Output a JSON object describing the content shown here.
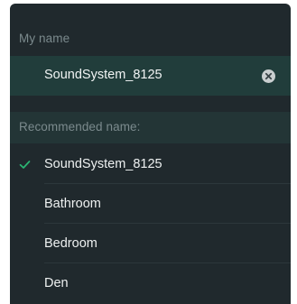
{
  "my_name": {
    "label": "My name",
    "value": "SoundSystem_8125",
    "clear_icon": "clear-circle-x-icon"
  },
  "recommended": {
    "label": "Recommended name:",
    "options": [
      {
        "label": "SoundSystem_8125",
        "selected": true
      },
      {
        "label": "Bathroom",
        "selected": false
      },
      {
        "label": "Bedroom",
        "selected": false
      },
      {
        "label": "Den",
        "selected": false
      }
    ],
    "check_icon": "checkmark-icon"
  },
  "colors": {
    "panel_bg": "#20292d",
    "field_bg": "#213d3b",
    "header_bg": "#233536",
    "accent": "#2bb673",
    "muted_text": "#7b8a8d",
    "text": "#f1f4f4"
  }
}
